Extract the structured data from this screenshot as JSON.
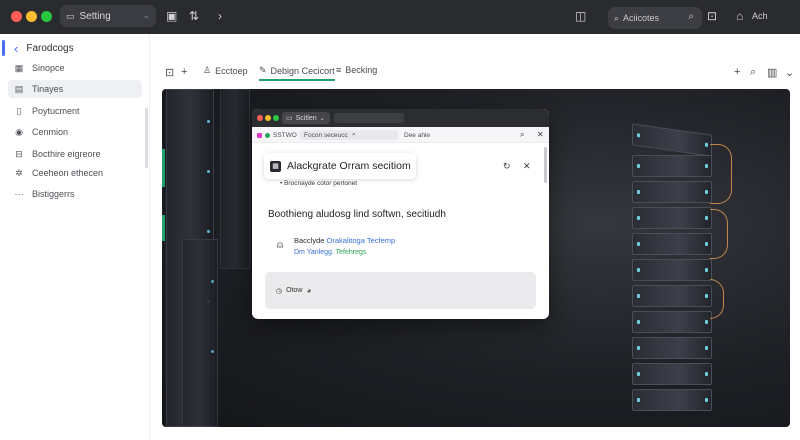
{
  "browser": {
    "tab_label": "Setting",
    "search_label": "Aciicotes",
    "profile_label": "Ach"
  },
  "sidebar": {
    "title": "Farodcogs",
    "items": [
      {
        "label": "Sinopce"
      },
      {
        "label": "Tinayes"
      },
      {
        "label": "Poytucment"
      },
      {
        "label": "Cenmion"
      },
      {
        "label": "Bocthire eigreore"
      },
      {
        "label": "Ceeheon ethecen"
      },
      {
        "label": "Bistiggerrs"
      }
    ]
  },
  "toolbar": {
    "items": [
      {
        "label": "Ecctoep"
      },
      {
        "label": "Debign Cecicort"
      },
      {
        "label": "Becking"
      }
    ]
  },
  "dialog": {
    "window_tab": "Scitlen",
    "site_tag": "SSTWO",
    "breadcrumb_1": "Focon seceuccs",
    "breadcrumb_2": "Dee ahle",
    "header_title": "Alackgrate Orram secitiom",
    "bullet": "Brocnayde cotor pertonet",
    "section_title": "Boothieng aludosg lind softwn, secitiudh",
    "row_title": "Bacclyde ",
    "row_title_link": "Orakalitoga Tecfemp",
    "row_sub_link": "Dm Yanlegg. ",
    "row_sub_green": "Tefehregs",
    "footer_label": "Otow"
  },
  "colors": {
    "accent_blue": "#4c6ef5",
    "accent_green": "#1fa36b",
    "titlebar": "#2a2b2f"
  }
}
